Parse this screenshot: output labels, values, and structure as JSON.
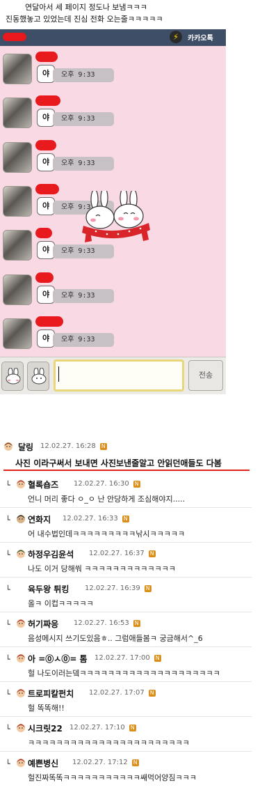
{
  "caption": {
    "line1": "연달아서 세 페이지 정도나 보냄ㅋㅋㅋ",
    "line2": "진동했놓고 있었는데 진심 전화 오는줄ㅋㅋㅋㅋㅋ"
  },
  "chat": {
    "app_title": "카카오톡",
    "colors": {
      "header": "#3e4e66",
      "background": "#f8d9e4",
      "redaction": "#e91a1e"
    },
    "messages": [
      {
        "text": "야",
        "time": "오후 9:33"
      },
      {
        "text": "야",
        "time": "오후 9:33"
      },
      {
        "text": "야",
        "time": "오후 9:33"
      },
      {
        "text": "야",
        "time": "오후 9:33"
      },
      {
        "text": "야",
        "time": "오후 9:33"
      },
      {
        "text": "야",
        "time": "오후 9:33"
      },
      {
        "text": "야",
        "time": "오후 9:33"
      }
    ],
    "send_label": "전송",
    "icons": [
      "bolt-icon",
      "bunny-emoticon-icon"
    ]
  },
  "comments": [
    {
      "author": "달링",
      "date": "12.02.27. 16:28",
      "text": "사진 이라구써서 보내면 사진보낸줄알고 안읽던애들도 다봄",
      "reply": false
    },
    {
      "author": "혈록숍즈",
      "date": "12.02.27. 16:30",
      "text": "언니 머리 좋다 ㅇ_ㅇ 난 안당하게 조심해야지.....",
      "reply": true
    },
    {
      "author": "연화지",
      "date": "12.02.27. 16:33",
      "text": "어 내수법인데ㅋㅋㅋㅋㅋㅋㅋㅋㅋ낚시ㅋㅋㅋㅋㅋ",
      "reply": true
    },
    {
      "author": "하정우김윤석",
      "date": "12.02.27. 16:37",
      "text": "나도 이거 당해쒀 ㅋㅋㅋㅋㅋㅋㅋㅋㅋㅋㅋㅋㅋ",
      "reply": true
    },
    {
      "author": "육두왕 튀킹",
      "date": "12.02.27. 16:39",
      "text": "올ㅋ 이컵ㅋㅋㅋㅋㅋ",
      "reply": true
    },
    {
      "author": "허기짜응",
      "date": "12.02.27. 16:53",
      "text": "음성메시지 쓰기도있음ㅎ.. 그럼애들봄ㅋ 궁금해서^_6",
      "reply": true
    },
    {
      "author": "아 =⓪ㅅ⓪= 톰",
      "date": "12.02.27. 17:00",
      "text": "헐 나도이러는뎈ㅋㅋㅋㅋㅋㅋㅋㅋㅋㅋㅋㅋㅋㅋㅋㅋㅋㅋㅋㅋ",
      "reply": true
    },
    {
      "author": "트로피칼펀치",
      "date": "12.02.27. 17:07",
      "text": "헐 똑똑해!!",
      "reply": true
    },
    {
      "author": "시크릿22",
      "date": "12.02.27. 17:10",
      "text": "ㅋㅋㅋㅋㅋㅋㅋㅋㅋㅋㅋㅋㅋㅋㅋㅋㅋㅋㅋㅋㅋㅋㅋ",
      "reply": true
    },
    {
      "author": "예쁜병신",
      "date": "12.02.27. 17:12",
      "text": "헐진짜똑똑ㅋㅋㅋㅋㅋㅋㅋㅋㅋㅋㅋ쌔먹어양짐ㅋㅋㅋ",
      "reply": true
    }
  ]
}
